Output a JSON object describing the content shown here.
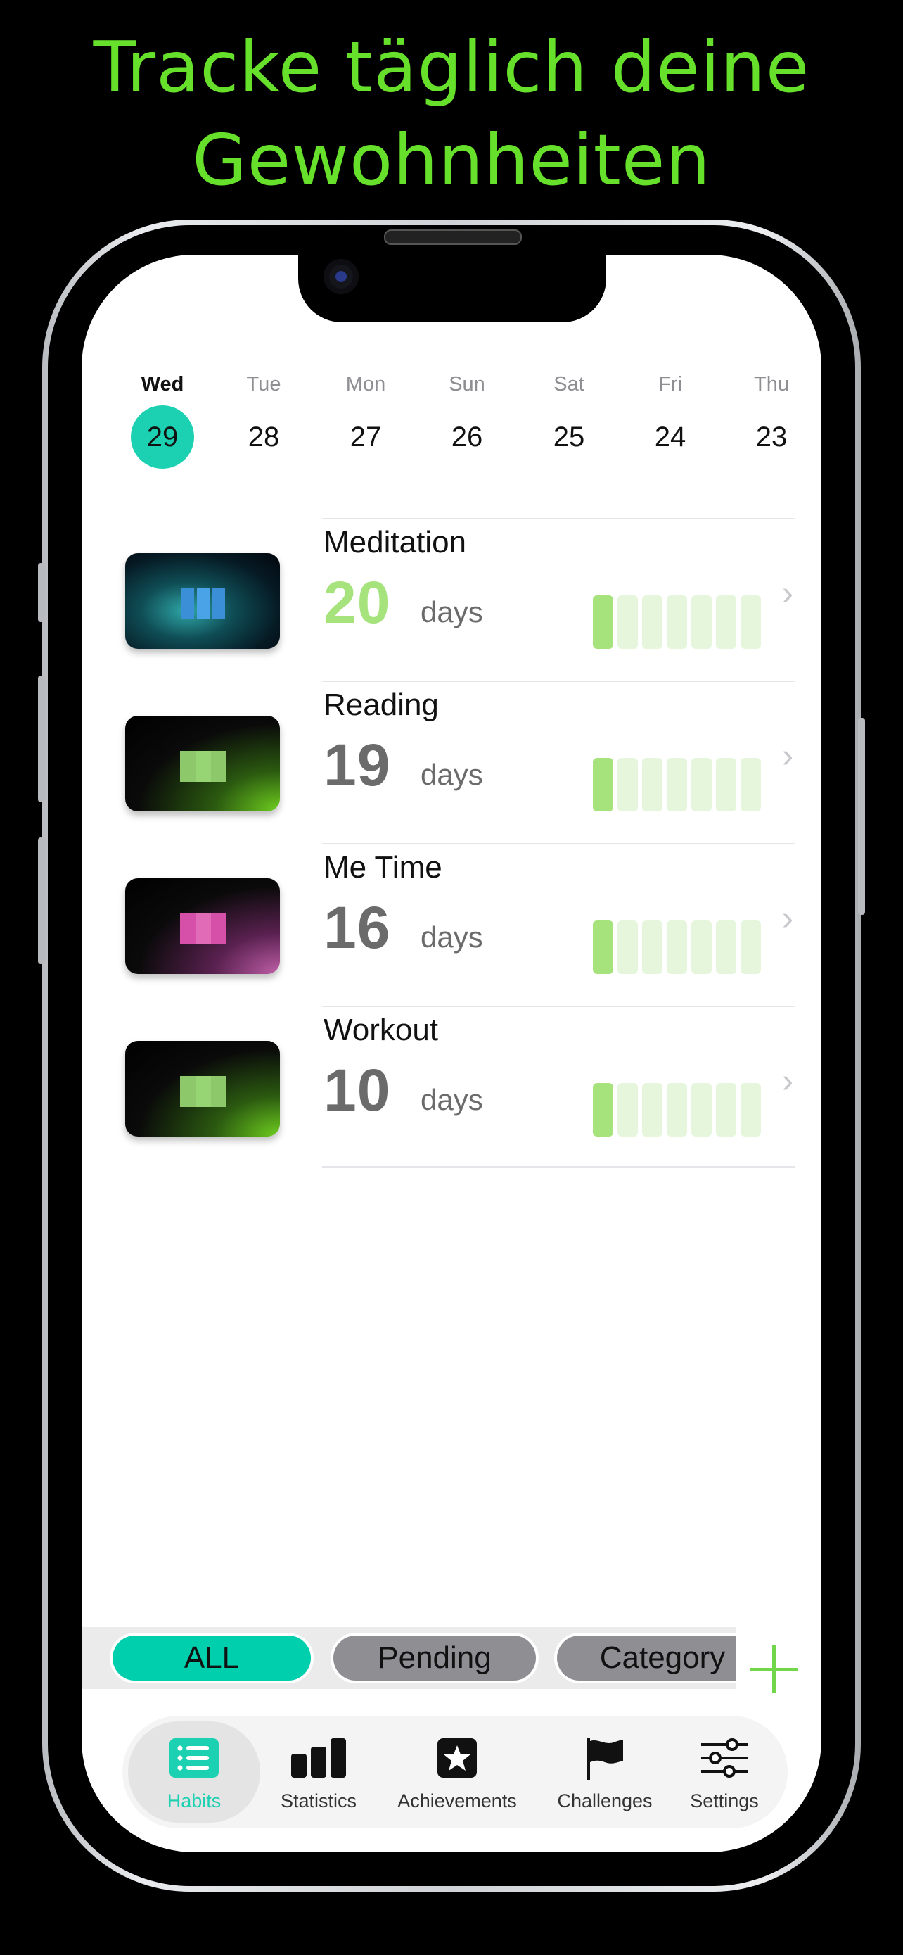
{
  "headline": {
    "line1": "Tracke täglich deine",
    "line2": "Gewohnheiten"
  },
  "days": [
    {
      "name": "Wed",
      "num": "29",
      "selected": true
    },
    {
      "name": "Tue",
      "num": "28"
    },
    {
      "name": "Mon",
      "num": "27"
    },
    {
      "name": "Sun",
      "num": "26"
    },
    {
      "name": "Sat",
      "num": "25"
    },
    {
      "name": "Fri",
      "num": "24"
    },
    {
      "name": "Thu",
      "num": "23"
    }
  ],
  "habits": [
    {
      "name": "Meditation",
      "count": "20",
      "unit": "days",
      "week_done": 1,
      "week_total": 7
    },
    {
      "name": "Reading",
      "count": "19",
      "unit": "days",
      "week_done": 1,
      "week_total": 7
    },
    {
      "name": "Me Time",
      "count": "16",
      "unit": "days",
      "week_done": 1,
      "week_total": 7
    },
    {
      "name": "Workout",
      "count": "10",
      "unit": "days",
      "week_done": 1,
      "week_total": 7
    }
  ],
  "filters": {
    "all": "ALL",
    "pending": "Pending",
    "category": "Category"
  },
  "tabs": {
    "habits": "Habits",
    "statistics": "Statistics",
    "achievements": "Achievements",
    "challenges": "Challenges",
    "settings": "Settings"
  },
  "colors": {
    "accent": "#1cd1b1",
    "streak": "#a6e37d",
    "headline": "#66e02a",
    "add": "#72d64a"
  }
}
